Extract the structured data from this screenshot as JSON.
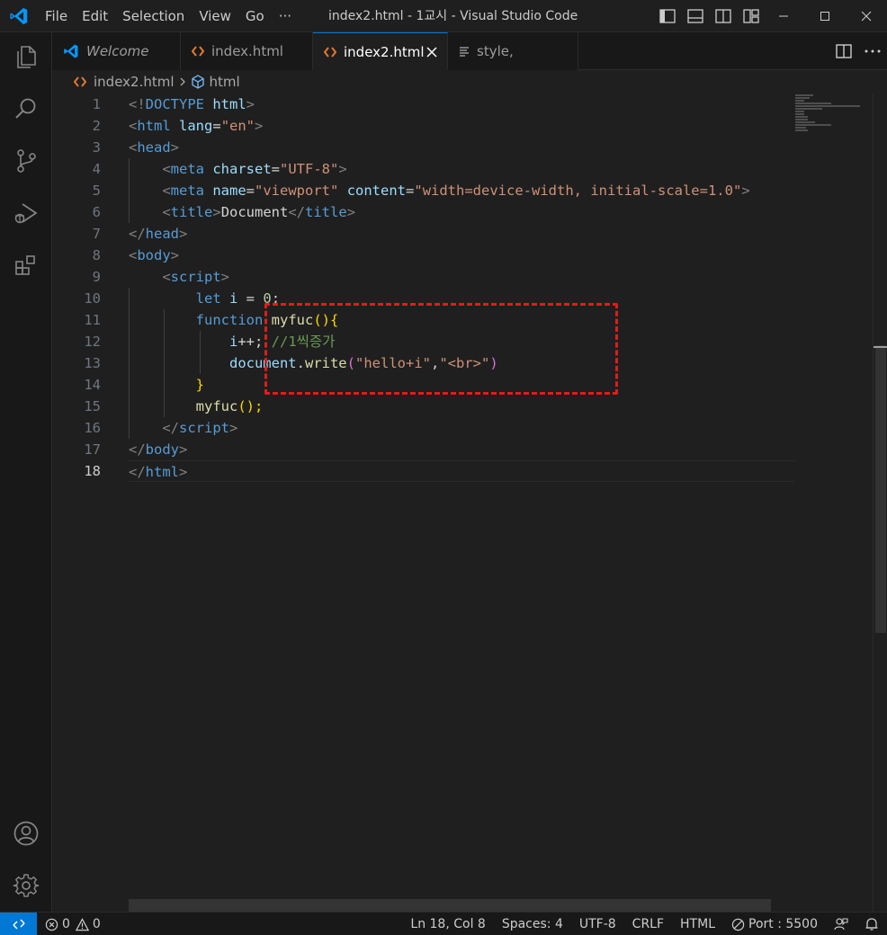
{
  "window": {
    "title": "index2.html - 1교시 - Visual Studio Code"
  },
  "menu": {
    "items": [
      "File",
      "Edit",
      "Selection",
      "View",
      "Go",
      "···"
    ]
  },
  "tabs": [
    {
      "label": "Welcome",
      "icon": "vscode-icon",
      "active": false
    },
    {
      "label": "index.html",
      "icon": "html-icon",
      "active": false
    },
    {
      "label": "index2.html",
      "icon": "html-icon",
      "active": true
    },
    {
      "label": "style,",
      "icon": "css-icon",
      "active": false
    }
  ],
  "breadcrumb": {
    "file": "index2.html",
    "symbol": "html"
  },
  "editor": {
    "current_line": 18,
    "line_numbers": [
      "1",
      "2",
      "3",
      "4",
      "5",
      "6",
      "7",
      "8",
      "9",
      "10",
      "11",
      "12",
      "13",
      "14",
      "15",
      "16",
      "17",
      "18"
    ],
    "code": {
      "l1_a": "<!",
      "l1_b": "DOCTYPE",
      "l1_c": " html",
      "l1_d": ">",
      "l2_tag": "html",
      "l2_attr": "lang",
      "l2_val": "\"en\"",
      "l3_tag": "head",
      "l4_tag": "meta",
      "l4_attr": "charset",
      "l4_val": "\"UTF-8\"",
      "l5_tag": "meta",
      "l5_attr1": "name",
      "l5_val1": "\"viewport\"",
      "l5_attr2": "content",
      "l5_val2": "\"width=device-width, initial-scale=1.0\"",
      "l6_tag": "title",
      "l6_text": "Document",
      "l6_tag2": "title",
      "l7_tag": "head",
      "l8_tag": "body",
      "l9_tag": "script",
      "l10_kw": "let",
      "l10_var": "i",
      "l10_op": " = ",
      "l10_num": "0",
      "l10_end": ";",
      "l11_kw": "function",
      "l11_fn": "myfuc",
      "l12_var": "i",
      "l12_op": "++; ",
      "l12_cmt": "//1씩증가",
      "l13_obj": "document",
      "l13_fn": "write",
      "l13_str1": "\"hello+i\"",
      "l13_comma": ",",
      "l13_str2": "\"<br>\"",
      "l14_brace": "}",
      "l15_fn": "myfuc",
      "l15_end": "();",
      "l16_tag": "script",
      "l17_tag": "body",
      "l18_tag": "html"
    }
  },
  "statusbar": {
    "errors": "0",
    "warnings": "0",
    "position": "Ln 18, Col 8",
    "spaces": "Spaces: 4",
    "encoding": "UTF-8",
    "eol": "CRLF",
    "language": "HTML",
    "port": "Port : 5500"
  },
  "colors": {
    "accent": "#0078d4",
    "highlight_box": "#e21b1b",
    "html_icon": "#e37933"
  }
}
